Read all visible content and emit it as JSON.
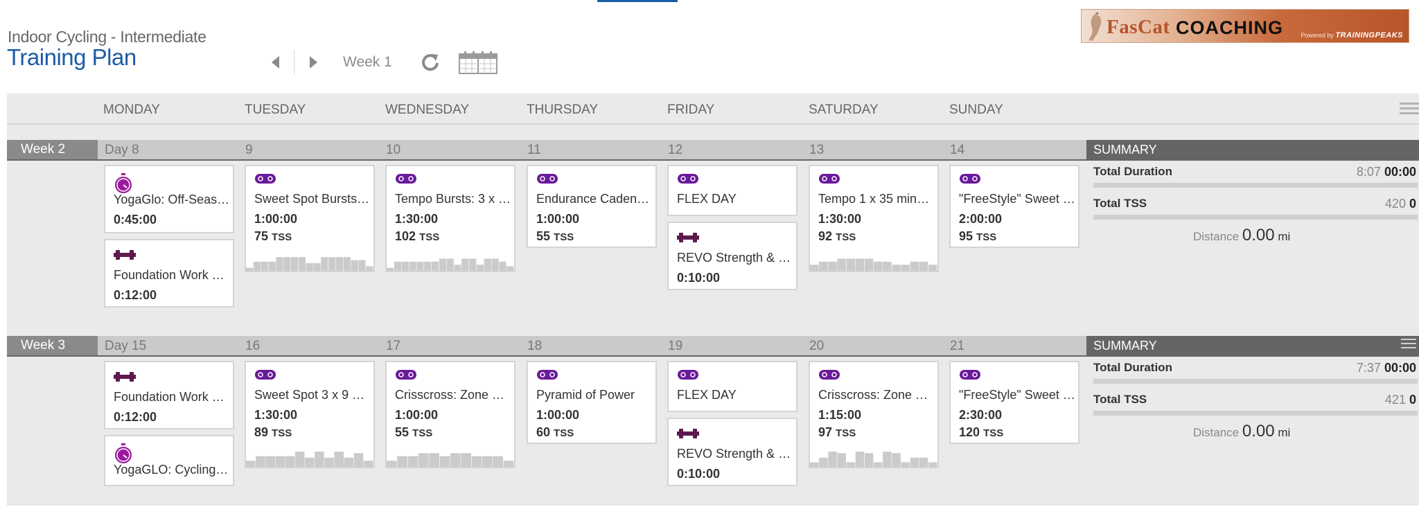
{
  "header": {
    "plan_subtitle": "Indoor Cycling - Intermediate",
    "plan_title": "Training Plan",
    "current_week": "Week 1"
  },
  "logo": {
    "brand_first": "FasCat",
    "brand_second": "COACHING",
    "powered_by": "Powered by",
    "powered_brand": "TRAININGPEAKS"
  },
  "colors": {
    "accent_blue": "#1a5ba6",
    "workout_purple": "#6a1a9a",
    "strength_purple": "#5e1a4e",
    "summary_dark": "#646567"
  },
  "day_headers": [
    "MONDAY",
    "TUESDAY",
    "WEDNESDAY",
    "THURSDAY",
    "FRIDAY",
    "SATURDAY",
    "SUNDAY"
  ],
  "weeks": [
    {
      "label": "Week 2",
      "days": [
        "Day 8",
        "9",
        "10",
        "11",
        "12",
        "13",
        "14"
      ],
      "summary": {
        "header": "SUMMARY",
        "duration_label": "Total Duration",
        "duration_planned": "8:07",
        "duration_completed": "00:00",
        "tss_label": "Total TSS",
        "tss_planned": "420",
        "tss_completed": "0",
        "distance_label": "Distance",
        "distance_value": "0.00",
        "distance_unit": "mi"
      },
      "workouts": [
        {
          "day": 0,
          "slot": 0,
          "type": "yoga",
          "title": "YogaGlo: Off-Seas…",
          "duration": "0:45:00"
        },
        {
          "day": 0,
          "slot": 1,
          "type": "strength",
          "title": "Foundation Work a…",
          "duration": "0:12:00"
        },
        {
          "day": 1,
          "slot": 0,
          "type": "bike",
          "title": "Sweet Spot Bursts…",
          "duration": "1:00:00",
          "tss": "75",
          "tss_unit": "TSS",
          "profile": [
            2,
            6,
            6,
            6,
            9,
            9,
            9,
            9,
            5,
            5,
            9,
            9,
            9,
            9,
            7,
            7,
            3
          ]
        },
        {
          "day": 2,
          "slot": 0,
          "type": "bike",
          "title": "Tempo Bursts: 3 x …",
          "duration": "1:30:00",
          "tss": "102",
          "tss_unit": "TSS",
          "profile": [
            2,
            6,
            6,
            6,
            6,
            6,
            6,
            8,
            8,
            4,
            8,
            8,
            4,
            8,
            8,
            6,
            3
          ]
        },
        {
          "day": 3,
          "slot": 0,
          "type": "bike",
          "title": "Endurance Caden…",
          "duration": "1:00:00",
          "tss": "55",
          "tss_unit": "TSS"
        },
        {
          "day": 4,
          "slot": 0,
          "type": "bike",
          "title": "FLEX DAY"
        },
        {
          "day": 4,
          "slot": 1,
          "type": "strength",
          "title": "REVO Strength & …",
          "duration": "0:10:00"
        },
        {
          "day": 5,
          "slot": 0,
          "type": "bike",
          "title": "Tempo 1 x 35 minu…",
          "duration": "1:30:00",
          "tss": "92",
          "tss_unit": "TSS",
          "profile": [
            4,
            6,
            6,
            8,
            8,
            8,
            8,
            6,
            6,
            4,
            4,
            6,
            6,
            4
          ]
        },
        {
          "day": 6,
          "slot": 0,
          "type": "bike",
          "title": "\"FreeStyle\" Sweet …",
          "duration": "2:00:00",
          "tss": "95",
          "tss_unit": "TSS"
        }
      ]
    },
    {
      "label": "Week 3",
      "days": [
        "Day 15",
        "16",
        "17",
        "18",
        "19",
        "20",
        "21"
      ],
      "summary": {
        "header": "SUMMARY",
        "duration_label": "Total Duration",
        "duration_planned": "7:37",
        "duration_completed": "00:00",
        "tss_label": "Total TSS",
        "tss_planned": "421",
        "tss_completed": "0",
        "distance_label": "Distance",
        "distance_value": "0.00",
        "distance_unit": "mi"
      },
      "workouts": [
        {
          "day": 0,
          "slot": 0,
          "type": "strength",
          "title": "Foundation Work a…",
          "duration": "0:12:00"
        },
        {
          "day": 0,
          "slot": 1,
          "type": "yoga",
          "title": "YogaGLO: Cycling …"
        },
        {
          "day": 1,
          "slot": 0,
          "type": "bike",
          "title": "Sweet Spot 3 x 9 …",
          "duration": "1:30:00",
          "tss": "89",
          "tss_unit": "TSS",
          "profile": [
            4,
            7,
            7,
            7,
            7,
            10,
            6,
            10,
            6,
            10,
            6,
            9,
            4
          ]
        },
        {
          "day": 2,
          "slot": 0,
          "type": "bike",
          "title": "Crisscross: Zone 3…",
          "duration": "1:00:00",
          "tss": "55",
          "tss_unit": "TSS",
          "profile": [
            4,
            7,
            7,
            9,
            9,
            7,
            9,
            9,
            7,
            7,
            7,
            4
          ]
        },
        {
          "day": 3,
          "slot": 0,
          "type": "bike",
          "title": "Pyramid of Power",
          "duration": "1:00:00",
          "tss": "60",
          "tss_unit": "TSS"
        },
        {
          "day": 4,
          "slot": 0,
          "type": "bike",
          "title": "FLEX DAY"
        },
        {
          "day": 4,
          "slot": 1,
          "type": "strength",
          "title": "REVO Strength & …",
          "duration": "0:10:00"
        },
        {
          "day": 5,
          "slot": 0,
          "type": "bike",
          "title": "Crisscross: Zone 4…",
          "duration": "1:15:00",
          "tss": "97",
          "tss_unit": "TSS",
          "profile": [
            3,
            6,
            10,
            9,
            3,
            10,
            9,
            3,
            10,
            9,
            3,
            6,
            6,
            3
          ]
        },
        {
          "day": 6,
          "slot": 0,
          "type": "bike",
          "title": "\"FreeStyle\" Sweet …",
          "duration": "2:30:00",
          "tss": "120",
          "tss_unit": "TSS"
        }
      ]
    }
  ]
}
